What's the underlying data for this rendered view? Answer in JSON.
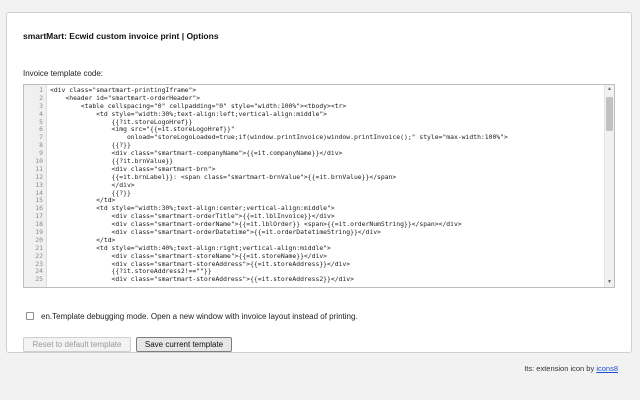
{
  "title": "smartMart: Ecwid custom invoice print | Options",
  "editor_label": "Invoice template code:",
  "code_lines": [
    {
      "n": "1",
      "text": "<div class=\"smartmart-printingIframe\">"
    },
    {
      "n": "2",
      "text": "    <header id=\"smartmart-orderHeader\">"
    },
    {
      "n": "3",
      "text": "        <table cellspacing=\"0\" cellpadding=\"0\" style=\"width:100%\"><tbody><tr>"
    },
    {
      "n": "4",
      "text": "            <td style=\"width:30%;text-align:left;vertical-align:middle\">"
    },
    {
      "n": "5",
      "text": "                {{?it.storeLogoHref}}"
    },
    {
      "n": "6",
      "text": "                <img src=\"{{=it.storeLogoHref}}\""
    },
    {
      "n": "7",
      "text": "                    onload=\"storeLogoLoaded=true;if(window.printInvoice)window.printInvoice();\" style=\"max-width:100%\">"
    },
    {
      "n": "8",
      "text": "                {{?}}"
    },
    {
      "n": "9",
      "text": "                <div class=\"smartmart-companyName\">{{=it.companyName}}</div>"
    },
    {
      "n": "10",
      "text": "                {{?it.brnValue}}"
    },
    {
      "n": "11",
      "text": "                <div class=\"smartmart-brn\">"
    },
    {
      "n": "12",
      "text": "                {{=it.brnLabel}}: <span class=\"smartmart-brnValue\">{{=it.brnValue}}</span>"
    },
    {
      "n": "13",
      "text": "                </div>"
    },
    {
      "n": "14",
      "text": "                {{?}}"
    },
    {
      "n": "15",
      "text": "            </td>"
    },
    {
      "n": "16",
      "text": "            <td style=\"width:30%;text-align:center;vertical-align:middle\">"
    },
    {
      "n": "17",
      "text": "                <div class=\"smartmart-orderTitle\">{{=it.lblInvoice}}</div>"
    },
    {
      "n": "18",
      "text": "                <div class=\"smartmart-orderName\">{{=it.lblOrder}} <span>{{=it.orderNumString}}</span></div>"
    },
    {
      "n": "19",
      "text": "                <div class=\"smartmart-orderDatetime\">{{=it.orderDatetimeString}}</div>"
    },
    {
      "n": "20",
      "text": "            </td>"
    },
    {
      "n": "21",
      "text": "            <td style=\"width:40%;text-align:right;vertical-align:middle\">"
    },
    {
      "n": "22",
      "text": "                <div class=\"smartmart-storeName\">{{=it.storeName}}</div>"
    },
    {
      "n": "23",
      "text": "                <div class=\"smartmart-storeAddress\">{{=it.storeAddress}}</div>"
    },
    {
      "n": "24",
      "text": "                {{?it.storeAddress2!==\"\"}}"
    },
    {
      "n": "25",
      "text": "                <div class=\"smartmart-storeAddress\">{{=it.storeAddress2}}</div>"
    }
  ],
  "debug_checkbox": {
    "checked": false,
    "label": "en.Template debugging mode. Open a new window with invoice layout instead of printing."
  },
  "buttons": {
    "reset": "Reset to default template",
    "save": "Save current template"
  },
  "footer": {
    "prefix": "Its: extension icon by ",
    "link": "icons8"
  }
}
